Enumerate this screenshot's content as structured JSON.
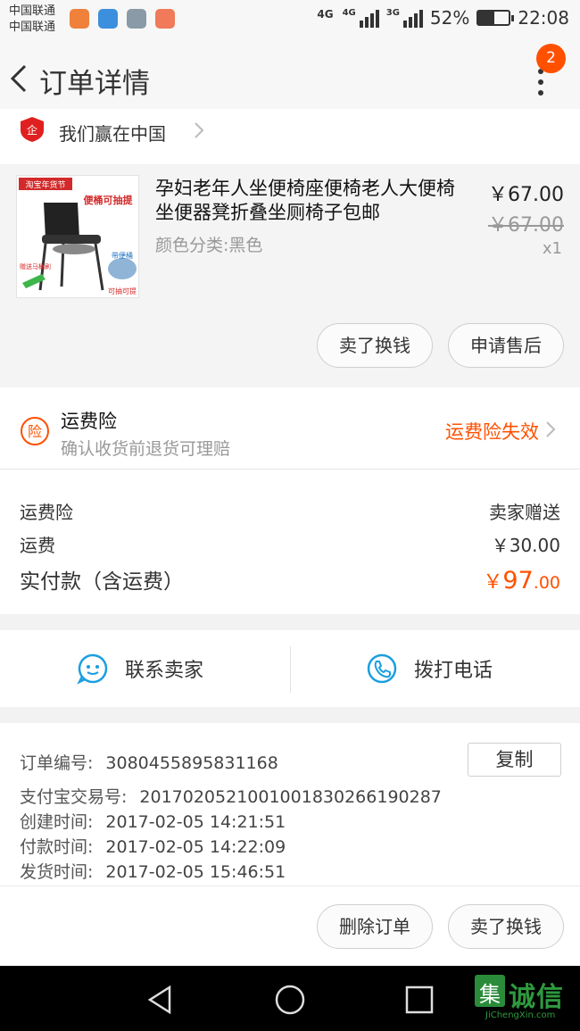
{
  "status_bar": {
    "carrier_1": "中国联通",
    "carrier_2": "中国联通",
    "network_1": "4G",
    "network_2": "4G",
    "network_3": "3G",
    "battery": "52%",
    "battery_level": 0.52,
    "time": "22:08"
  },
  "header": {
    "title": "订单详情",
    "badge_count": "2"
  },
  "shop": {
    "name": "我们赢在中国"
  },
  "product": {
    "title": "孕妇老年人坐便椅座便椅老人大便椅坐便器凳折叠坐厕椅子包邮",
    "sku": "颜色分类:黑色",
    "price": "￥67.00",
    "original_price": "￥67.00",
    "quantity": "x1",
    "image_banner": "淘宝年货节",
    "image_tag_1": "便桶可抽提",
    "image_tag_2": "带便桶",
    "image_tag_3": "可抽可提",
    "image_tag_4": "赠送马桶刷",
    "sell_button": "卖了换钱",
    "after_sale_button": "申请售后"
  },
  "insurance": {
    "title": "运费险",
    "subtitle": "确认收货前退货可理赔",
    "status": "运费险失效",
    "icon_char": "险"
  },
  "fees": {
    "insurance_label": "运费险",
    "insurance_value": "卖家赠送",
    "shipping_label": "运费",
    "shipping_value": "￥30.00",
    "paid_label": "实付款（含运费）",
    "paid_currency": "￥",
    "paid_int": "97",
    "paid_dec": ".00"
  },
  "contact": {
    "seller_label": "联系卖家",
    "phone_label": "拨打电话"
  },
  "order_info": {
    "order_no_label": "订单编号:",
    "order_no": "3080455895831168",
    "copy_label": "复制",
    "alipay_label": "支付宝交易号:",
    "alipay_no": "2017020521001001830266190287",
    "created_label": "创建时间:",
    "created": "2017-02-05 14:21:51",
    "paid_label": "付款时间:",
    "paid": "2017-02-05 14:22:09",
    "shipped_label": "发货时间:",
    "shipped": "2017-02-05 15:46:51"
  },
  "actions": {
    "delete_label": "删除订单",
    "sell_label": "卖了换钱"
  },
  "watermark": {
    "text": "诚信",
    "logo_char": "集",
    "sub": "JiChengXin.com"
  },
  "colors": {
    "accent": "#ff5000",
    "blue_icon": "#1a9fe0"
  }
}
